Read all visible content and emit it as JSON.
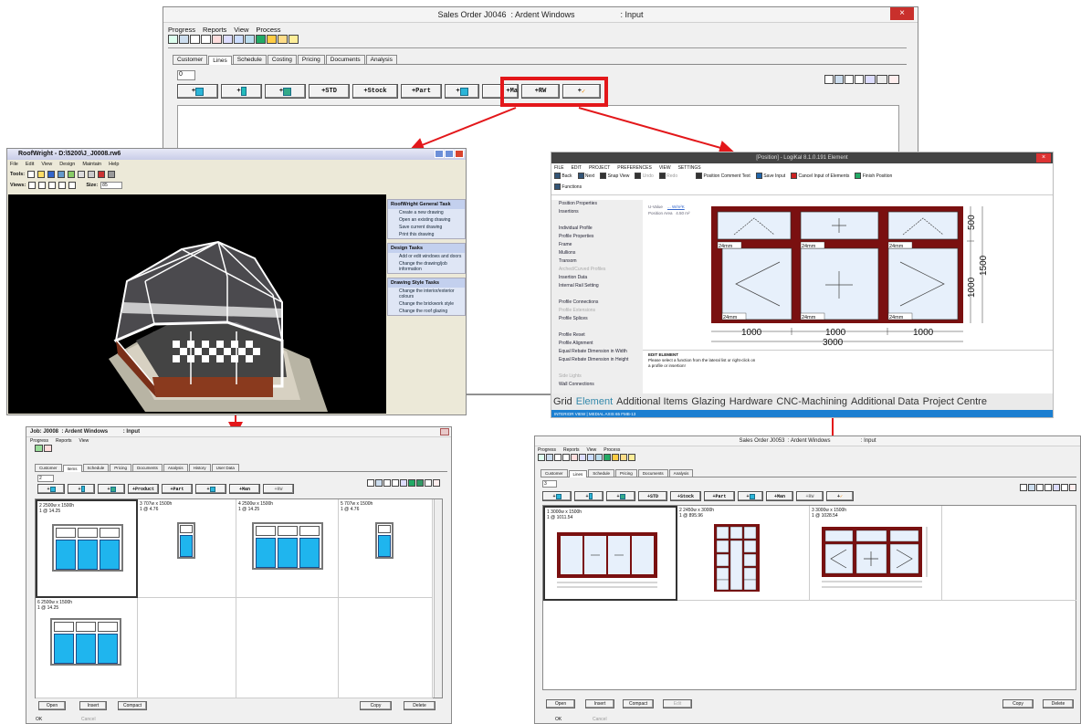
{
  "main": {
    "title": "Sales Order J0046  : Ardent Windows                    : Input",
    "menu": [
      "Progress",
      "Reports",
      "View",
      "Process"
    ],
    "tabs": [
      "Customer",
      "Lines",
      "Schedule",
      "Costing",
      "Pricing",
      "Documents",
      "Analysis"
    ],
    "field_value": "0",
    "buttons": [
      "+",
      "+",
      "+",
      "+STD",
      "+Stock",
      "+Part",
      "+",
      "+Ma",
      "+RW",
      "+"
    ],
    "close": "×"
  },
  "roofwright": {
    "title": "RoofWright - D:\\5200\\J_J0008.rw6",
    "menu": [
      "File",
      "Edit",
      "View",
      "Design",
      "Maintain",
      "Help"
    ],
    "tools_label": "Tools:",
    "views_label": "Views:",
    "size_label": "Size:",
    "size_value": "85",
    "groups": [
      {
        "header": "RoofWright General Task",
        "items": [
          "Create a new drawing",
          "Open an existing drawing",
          "Save current drawing",
          "Print this drawing"
        ]
      },
      {
        "header": "Design Tasks",
        "items": [
          "Add or edit windows and doors",
          "Change the drawing/job information"
        ]
      },
      {
        "header": "Drawing Style Tasks",
        "items": [
          "Change the interior/exterior colours",
          "Change the brickwork style",
          "Change the roof glazing"
        ]
      }
    ]
  },
  "logikal": {
    "title": "[Position] - LogiKal 8.1.0.191 Element",
    "menu": [
      "FILE",
      "EDIT",
      "PROJECT",
      "PREFERENCES",
      "VIEW",
      "SETTINGS"
    ],
    "toolbar": [
      "Back",
      "Next",
      "Snap View",
      "Undo",
      "Redo",
      "Position Comment Text",
      "Save Input",
      "Cancel Input of Elements",
      "Finish Position"
    ],
    "functions": "Functions",
    "side": [
      "Position Properties",
      "Insertions",
      "",
      "Individual Profile",
      "Profile Properties",
      "Frame",
      "Mullions",
      "Transom",
      "Arched/Curved Profiles",
      "Insertion Data",
      "Internal Rail Setting",
      "",
      "Profile Connections",
      "Profile Extensions",
      "Profile Splices",
      "",
      "Profile Reset",
      "Profile Alignment",
      "Equal Rebate Dimension in Width",
      "Equal Rebate Dimension in Height",
      "",
      "Side Lights",
      "Wall Connections"
    ],
    "info_labels": [
      "U-Value",
      "Position Area"
    ],
    "info_values": [
      "... W/m²K",
      "4.50 m²"
    ],
    "dims": {
      "top": "500",
      "bottom": "1000",
      "total_h": "1500",
      "widths": [
        "1000",
        "1000",
        "1000"
      ],
      "total_w": "3000",
      "mm": "24mm"
    },
    "edit_title": "EDIT ELEMENT",
    "edit_text": "Please select a function from the lateral list or right-click on a profile or insertion!",
    "tabs": [
      "Grid",
      "Element",
      "Additional Items",
      "Glazing",
      "Hardware",
      "CNC-Machining",
      "Additional Data",
      "Project Centre"
    ],
    "status": "INTERIOR VIEW  | MEDIAL AXIS 65  FMB-13"
  },
  "job": {
    "title": "Job: J0008  : Ardent Windows          : Input",
    "menu": [
      "Progress",
      "Reports",
      "View"
    ],
    "tabs": [
      "Customer",
      "Items",
      "Schedule",
      "Pricing",
      "Documents",
      "Analysis",
      "History",
      "User Data"
    ],
    "field_value": "2",
    "buttons": [
      "+",
      "+",
      "+",
      "+Product",
      "+Part",
      "+",
      "+Man",
      "+RW"
    ],
    "cells": [
      {
        "label": "2  2500w x 1500h",
        "sub": "1 @ 14.25"
      },
      {
        "label": "3  707w x 1500h",
        "sub": "1 @ 4.76"
      },
      {
        "label": "4  2500w x 1500h",
        "sub": "1 @ 14.25"
      },
      {
        "label": "5  707w x 1500h",
        "sub": "1 @ 4.76"
      },
      {
        "label": "6  2500w x 1500h",
        "sub": "1 @ 14.25"
      }
    ],
    "bottom_buttons": [
      "Open",
      "Insert",
      "Compact",
      "Copy",
      "Delete"
    ],
    "ok": "OK",
    "cancel": "Cancel"
  },
  "so53": {
    "title": "Sales Order J0053  : Ardent Windows                    : Input",
    "menu": [
      "Progress",
      "Reports",
      "View",
      "Process"
    ],
    "tabs": [
      "Customer",
      "Lines",
      "Schedule",
      "Pricing",
      "Documents",
      "Analysis"
    ],
    "field_value": "3",
    "buttons": [
      "+",
      "+",
      "+",
      "+STD",
      "+Stock",
      "+Part",
      "+",
      "+Man",
      "+RW",
      "+"
    ],
    "cells": [
      {
        "label": "1  3000w x 1500h",
        "sub": "1 @ 1011.54"
      },
      {
        "label": "2  2450w x 3000h",
        "sub": "1 @ 895.96"
      },
      {
        "label": "3  3000w x 1500h",
        "sub": "1 @ 1028.54"
      }
    ],
    "bottom_buttons": [
      "Open",
      "Insert",
      "Compact",
      "Edit",
      "Copy",
      "Delete"
    ],
    "ok": "OK",
    "cancel": "Cancel"
  },
  "colors": {
    "accent_red": "#e3171a",
    "frame": "#7a1010",
    "glass": "#1fb5ee"
  }
}
